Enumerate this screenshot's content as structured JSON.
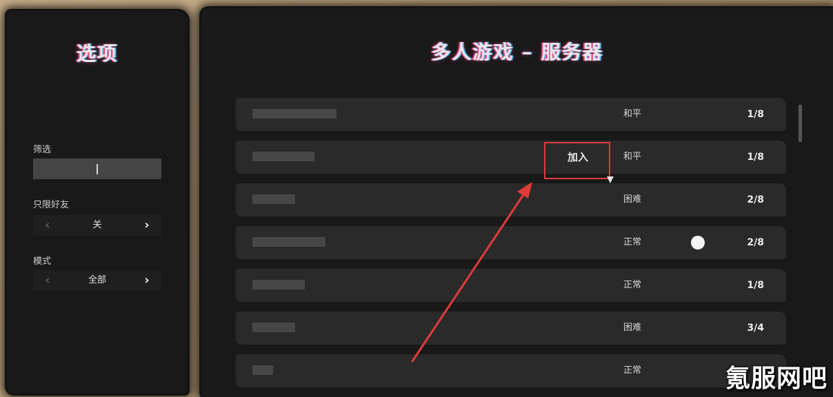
{
  "left_panel": {
    "title": "选项",
    "filter_label": "筛选",
    "filter_value": "",
    "friends_label": "只限好友",
    "friends_value": "关",
    "mode_label": "模式",
    "mode_value": "全部",
    "prev_symbol": "‹",
    "next_symbol": "›"
  },
  "right_panel": {
    "title": "多人游戏 – 服务器",
    "join_label": "加入"
  },
  "servers": [
    {
      "mode": "和平",
      "players": "1/8"
    },
    {
      "mode": "和平",
      "players": "1/8"
    },
    {
      "mode": "困难",
      "players": "2/8"
    },
    {
      "mode": "正常",
      "players": "2/8"
    },
    {
      "mode": "正常",
      "players": "1/8"
    },
    {
      "mode": "困难",
      "players": "3/4"
    },
    {
      "mode": "正常",
      "players": ""
    }
  ],
  "watermark": "氪服网吧",
  "colors": {
    "highlight": "#e23a3a",
    "panel": "#1a1919",
    "row": "#2a2a2a"
  }
}
